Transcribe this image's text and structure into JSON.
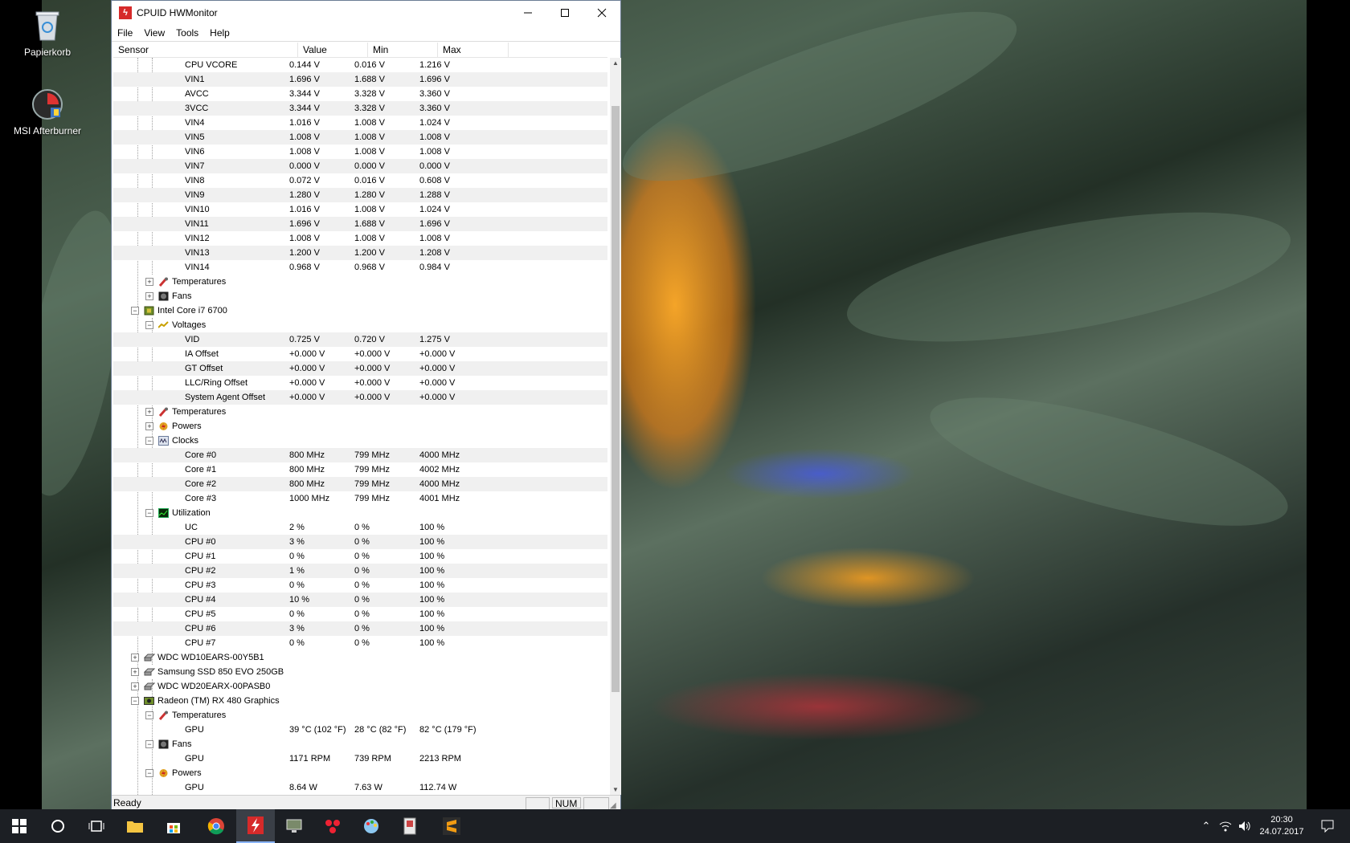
{
  "desktop": {
    "icons": [
      {
        "label": "Papierkorb"
      },
      {
        "label": "MSI Afterburner"
      }
    ]
  },
  "window": {
    "title": "CPUID HWMonitor",
    "menu": [
      "File",
      "View",
      "Tools",
      "Help"
    ],
    "columns": [
      "Sensor",
      "Value",
      "Min",
      "Max"
    ],
    "status": "Ready",
    "num_indicator": "NUM"
  },
  "rows": [
    {
      "d": 3,
      "label": "CPU VCORE",
      "value": "0.144 V",
      "min": "0.016 V",
      "max": "1.216 V"
    },
    {
      "d": 3,
      "label": "VIN1",
      "value": "1.696 V",
      "min": "1.688 V",
      "max": "1.696 V"
    },
    {
      "d": 3,
      "label": "AVCC",
      "value": "3.344 V",
      "min": "3.328 V",
      "max": "3.360 V"
    },
    {
      "d": 3,
      "label": "3VCC",
      "value": "3.344 V",
      "min": "3.328 V",
      "max": "3.360 V"
    },
    {
      "d": 3,
      "label": "VIN4",
      "value": "1.016 V",
      "min": "1.008 V",
      "max": "1.024 V"
    },
    {
      "d": 3,
      "label": "VIN5",
      "value": "1.008 V",
      "min": "1.008 V",
      "max": "1.008 V"
    },
    {
      "d": 3,
      "label": "VIN6",
      "value": "1.008 V",
      "min": "1.008 V",
      "max": "1.008 V"
    },
    {
      "d": 3,
      "label": "VIN7",
      "value": "0.000 V",
      "min": "0.000 V",
      "max": "0.000 V"
    },
    {
      "d": 3,
      "label": "VIN8",
      "value": "0.072 V",
      "min": "0.016 V",
      "max": "0.608 V"
    },
    {
      "d": 3,
      "label": "VIN9",
      "value": "1.280 V",
      "min": "1.280 V",
      "max": "1.288 V"
    },
    {
      "d": 3,
      "label": "VIN10",
      "value": "1.016 V",
      "min": "1.008 V",
      "max": "1.024 V"
    },
    {
      "d": 3,
      "label": "VIN11",
      "value": "1.696 V",
      "min": "1.688 V",
      "max": "1.696 V"
    },
    {
      "d": 3,
      "label": "VIN12",
      "value": "1.008 V",
      "min": "1.008 V",
      "max": "1.008 V"
    },
    {
      "d": 3,
      "label": "VIN13",
      "value": "1.200 V",
      "min": "1.200 V",
      "max": "1.208 V"
    },
    {
      "d": 3,
      "label": "VIN14",
      "value": "0.968 V",
      "min": "0.968 V",
      "max": "0.984 V"
    },
    {
      "d": 2,
      "label": "Temperatures",
      "toggle": "+",
      "icon": "temperature-icon"
    },
    {
      "d": 2,
      "label": "Fans",
      "toggle": "+",
      "icon": "fan-icon"
    },
    {
      "d": 1,
      "label": "Intel Core i7 6700",
      "toggle": "-",
      "icon": "cpu-chip-icon"
    },
    {
      "d": 2,
      "label": "Voltages",
      "toggle": "-",
      "icon": "voltage-icon"
    },
    {
      "d": 3,
      "label": "VID",
      "value": "0.725 V",
      "min": "0.720 V",
      "max": "1.275 V"
    },
    {
      "d": 3,
      "label": "IA Offset",
      "value": "+0.000 V",
      "min": "+0.000 V",
      "max": "+0.000 V"
    },
    {
      "d": 3,
      "label": "GT Offset",
      "value": "+0.000 V",
      "min": "+0.000 V",
      "max": "+0.000 V"
    },
    {
      "d": 3,
      "label": "LLC/Ring Offset",
      "value": "+0.000 V",
      "min": "+0.000 V",
      "max": "+0.000 V"
    },
    {
      "d": 3,
      "label": "System Agent Offset",
      "value": "+0.000 V",
      "min": "+0.000 V",
      "max": "+0.000 V"
    },
    {
      "d": 2,
      "label": "Temperatures",
      "toggle": "+",
      "icon": "temperature-icon"
    },
    {
      "d": 2,
      "label": "Powers",
      "toggle": "+",
      "icon": "power-icon"
    },
    {
      "d": 2,
      "label": "Clocks",
      "toggle": "-",
      "icon": "clock-icon"
    },
    {
      "d": 3,
      "label": "Core #0",
      "value": "800 MHz",
      "min": "799 MHz",
      "max": "4000 MHz"
    },
    {
      "d": 3,
      "label": "Core #1",
      "value": "800 MHz",
      "min": "799 MHz",
      "max": "4002 MHz"
    },
    {
      "d": 3,
      "label": "Core #2",
      "value": "800 MHz",
      "min": "799 MHz",
      "max": "4000 MHz"
    },
    {
      "d": 3,
      "label": "Core #3",
      "value": "1000 MHz",
      "min": "799 MHz",
      "max": "4001 MHz"
    },
    {
      "d": 2,
      "label": "Utilization",
      "toggle": "-",
      "icon": "utilization-icon"
    },
    {
      "d": 3,
      "label": "UC",
      "value": "2 %",
      "min": "0 %",
      "max": "100 %"
    },
    {
      "d": 3,
      "label": "CPU #0",
      "value": "3 %",
      "min": "0 %",
      "max": "100 %"
    },
    {
      "d": 3,
      "label": "CPU #1",
      "value": "0 %",
      "min": "0 %",
      "max": "100 %"
    },
    {
      "d": 3,
      "label": "CPU #2",
      "value": "1 %",
      "min": "0 %",
      "max": "100 %"
    },
    {
      "d": 3,
      "label": "CPU #3",
      "value": "0 %",
      "min": "0 %",
      "max": "100 %"
    },
    {
      "d": 3,
      "label": "CPU #4",
      "value": "10 %",
      "min": "0 %",
      "max": "100 %"
    },
    {
      "d": 3,
      "label": "CPU #5",
      "value": "0 %",
      "min": "0 %",
      "max": "100 %"
    },
    {
      "d": 3,
      "label": "CPU #6",
      "value": "3 %",
      "min": "0 %",
      "max": "100 %"
    },
    {
      "d": 3,
      "label": "CPU #7",
      "value": "0 %",
      "min": "0 %",
      "max": "100 %"
    },
    {
      "d": 1,
      "label": "WDC WD10EARS-00Y5B1",
      "toggle": "+",
      "icon": "hard-drive-icon"
    },
    {
      "d": 1,
      "label": "Samsung SSD 850 EVO 250GB",
      "toggle": "+",
      "icon": "hard-drive-icon"
    },
    {
      "d": 1,
      "label": "WDC WD20EARX-00PASB0",
      "toggle": "+",
      "icon": "hard-drive-icon"
    },
    {
      "d": 1,
      "label": "Radeon (TM) RX 480 Graphics",
      "toggle": "-",
      "icon": "gpu-icon"
    },
    {
      "d": 2,
      "label": "Temperatures",
      "toggle": "-",
      "icon": "temperature-icon"
    },
    {
      "d": 3,
      "label": "GPU",
      "value": "39 °C  (102 °F)",
      "min": "28 °C  (82 °F)",
      "max": "82 °C  (179 °F)"
    },
    {
      "d": 2,
      "label": "Fans",
      "toggle": "-",
      "icon": "fan-icon"
    },
    {
      "d": 3,
      "label": "GPU",
      "value": "1171 RPM",
      "min": "739 RPM",
      "max": "2213 RPM"
    },
    {
      "d": 2,
      "label": "Powers",
      "toggle": "-",
      "icon": "power-icon"
    },
    {
      "d": 3,
      "label": "GPU",
      "value": "8.64 W",
      "min": "7.63 W",
      "max": "112.74 W"
    }
  ],
  "taskbar": {
    "clock_time": "20:30",
    "clock_date": "24.07.2017"
  },
  "colors": {
    "accent": "#0078d7",
    "title_icon": "#d62a2a",
    "taskbar": "#1c1f24"
  }
}
